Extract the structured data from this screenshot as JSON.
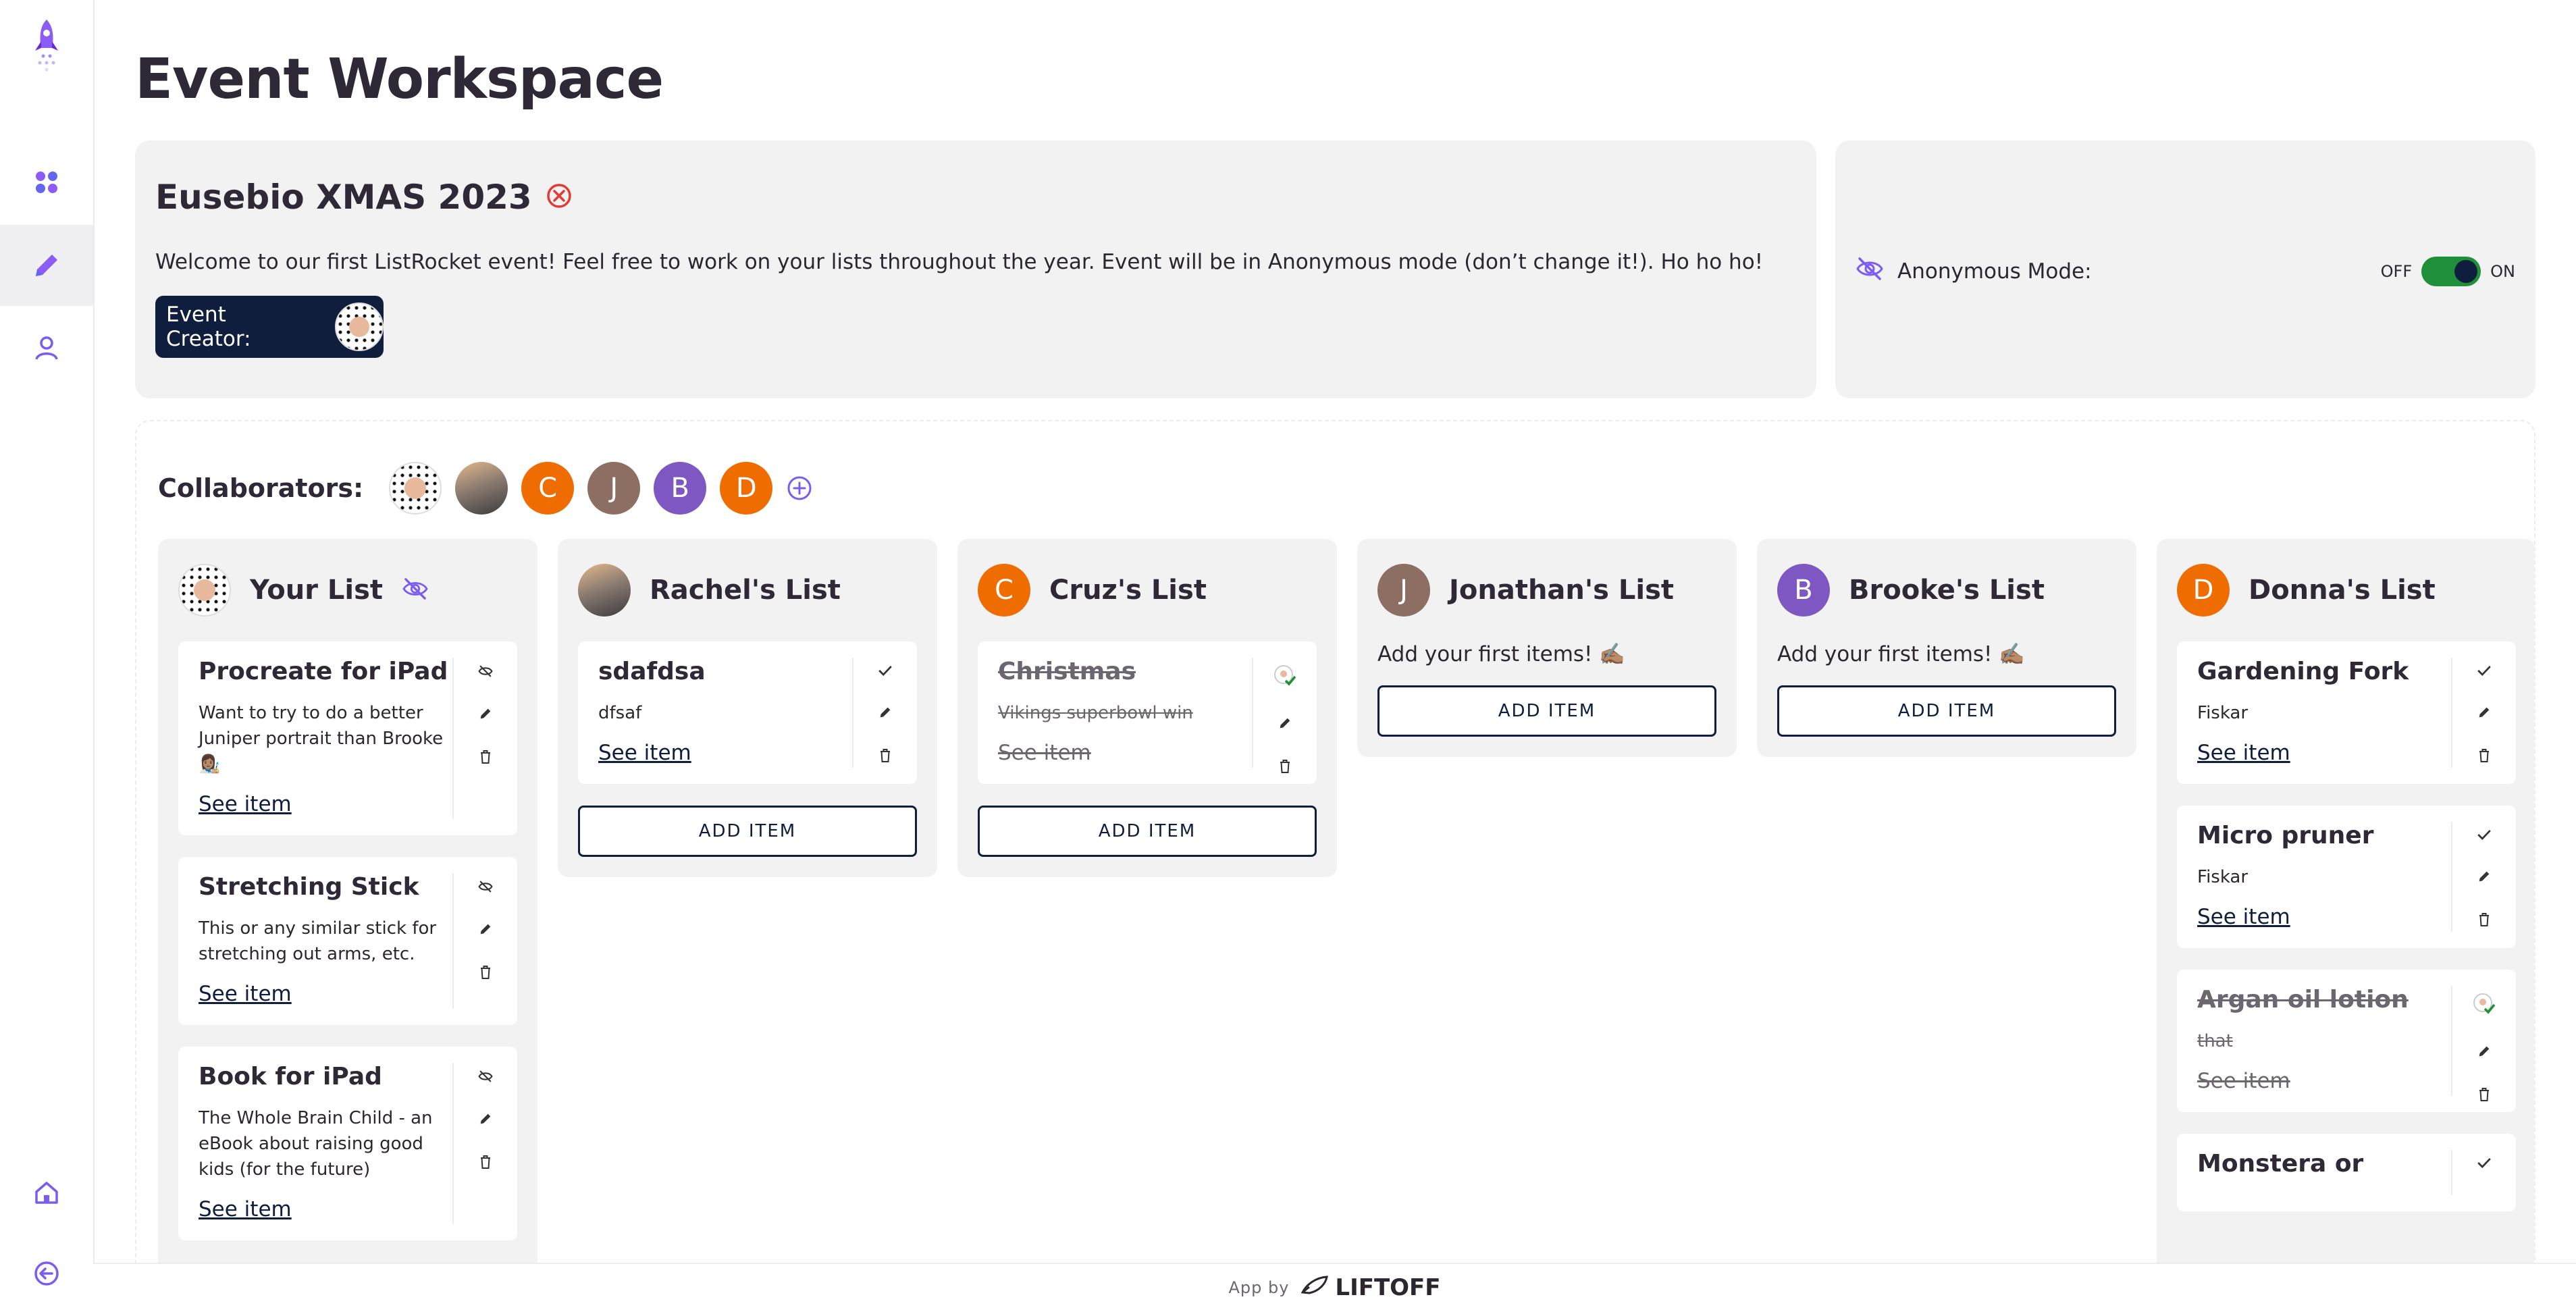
{
  "sidebar": {
    "icons": [
      "rocket-logo-icon",
      "dashboard-icon",
      "edit-icon",
      "profile-icon",
      "home-icon",
      "logout-icon"
    ]
  },
  "page": {
    "title": "Event Workspace"
  },
  "event": {
    "name": "Eusebio XMAS 2023",
    "description": "Welcome to our first ListRocket event! Feel free to work on your lists throughout the year. Event will be in Anonymous mode (don’t change it!). Ho ho ho!",
    "creator_label": "Event Creator:"
  },
  "anonymous": {
    "label": "Anonymous Mode:",
    "off_label": "OFF",
    "on_label": "ON",
    "enabled": true
  },
  "collaborators": {
    "label": "Collaborators:",
    "people": [
      {
        "initial": "",
        "color": "#ffffff",
        "kind": "dots"
      },
      {
        "initial": "",
        "color": "#8d7d72",
        "kind": "photo"
      },
      {
        "initial": "C",
        "color": "#ef6c00",
        "kind": "letter"
      },
      {
        "initial": "J",
        "color": "#8d6e63",
        "kind": "letter"
      },
      {
        "initial": "B",
        "color": "#7e57c2",
        "kind": "letter"
      },
      {
        "initial": "D",
        "color": "#ef6c00",
        "kind": "letter"
      }
    ]
  },
  "lists": [
    {
      "name": "Your List",
      "items": [
        {
          "title": "Procreate for iPad",
          "desc": "Want to try to do a better Juniper portrait than Brooke 👩🏽‍🎨",
          "link": "See item"
        },
        {
          "title": "Stretching Stick",
          "desc": "This or any similar stick for stretching out arms, etc.",
          "link": "See item"
        },
        {
          "title": "Book for iPad",
          "desc": "The Whole Brain Child - an eBook about raising good kids (for the future)",
          "link": "See item"
        }
      ]
    },
    {
      "name": "Rachel's List",
      "items": [
        {
          "title": "sdafdsa",
          "desc": "dfsaf",
          "link": "See item"
        }
      ],
      "add_label": "ADD ITEM"
    },
    {
      "name": "Cruz's List",
      "items": [
        {
          "title": "Christmas",
          "desc": "Vikings superbowl win",
          "link": "See item"
        }
      ],
      "add_label": "ADD ITEM"
    },
    {
      "name": "Jonathan's List",
      "empty_msg": "Add your first items! ✍🏽",
      "add_label": "ADD ITEM"
    },
    {
      "name": "Brooke's List",
      "empty_msg": "Add your first items! ✍🏽",
      "add_label": "ADD ITEM"
    },
    {
      "name": "Donna's List",
      "items": [
        {
          "title": "Gardening Fork",
          "desc": "Fiskar",
          "link": "See item"
        },
        {
          "title": "Micro pruner",
          "desc": "Fiskar",
          "link": "See item"
        },
        {
          "title": "Argan oil lotion",
          "desc": "that",
          "link": "See item"
        },
        {
          "title": "Monstera or",
          "desc": "",
          "link": ""
        }
      ]
    }
  ],
  "footer": {
    "by": "App by",
    "brand": "LIFTOFF"
  },
  "colors": {
    "navy": "#0f1e3d",
    "purple": "#7c3aed",
    "bg_card": "#f2f2f2",
    "orange": "#ef6c00",
    "toggle_green": "#1f8f3a",
    "remove_red": "#e53935"
  }
}
